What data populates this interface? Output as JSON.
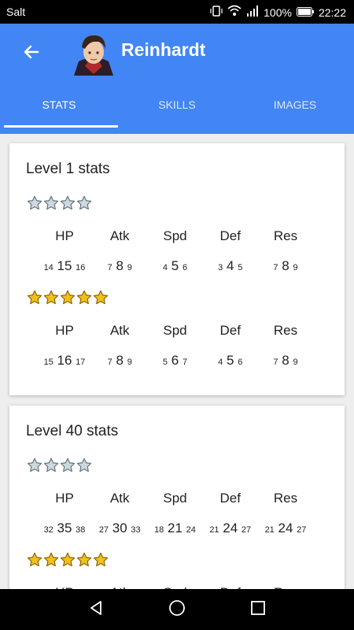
{
  "statusbar": {
    "carrier": "Salt",
    "battery": "100%",
    "time": "22:22"
  },
  "appbar": {
    "title": "Reinhardt",
    "tabs": [
      "STATS",
      "SKILLS",
      "IMAGES"
    ]
  },
  "cards": [
    {
      "title": "Level 1 stats",
      "columns": [
        "HP",
        "Atk",
        "Spd",
        "Def",
        "Res"
      ],
      "rarities": [
        {
          "stars": 4,
          "color": "silver",
          "values": [
            [
              "14",
              "15",
              "16"
            ],
            [
              "7",
              "8",
              "9"
            ],
            [
              "4",
              "5",
              "6"
            ],
            [
              "3",
              "4",
              "5"
            ],
            [
              "7",
              "8",
              "9"
            ]
          ]
        },
        {
          "stars": 5,
          "color": "gold",
          "values": [
            [
              "15",
              "16",
              "17"
            ],
            [
              "7",
              "8",
              "9"
            ],
            [
              "5",
              "6",
              "7"
            ],
            [
              "4",
              "5",
              "6"
            ],
            [
              "7",
              "8",
              "9"
            ]
          ]
        }
      ]
    },
    {
      "title": "Level 40 stats",
      "columns": [
        "HP",
        "Atk",
        "Spd",
        "Def",
        "Res"
      ],
      "rarities": [
        {
          "stars": 4,
          "color": "silver",
          "values": [
            [
              "32",
              "35",
              "38"
            ],
            [
              "27",
              "30",
              "33"
            ],
            [
              "18",
              "21",
              "24"
            ],
            [
              "21",
              "24",
              "27"
            ],
            [
              "21",
              "24",
              "27"
            ]
          ]
        },
        {
          "stars": 5,
          "color": "gold",
          "values": []
        }
      ]
    }
  ],
  "nav": {
    "back_icon": "triangle-back",
    "home_icon": "circle-home",
    "recents_icon": "square-recents"
  }
}
